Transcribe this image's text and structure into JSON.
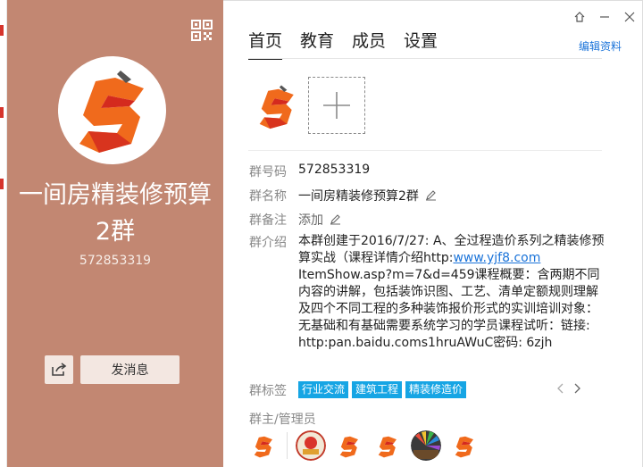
{
  "app": {
    "title": "一间房精装修预算2群",
    "group_id": "572853319"
  },
  "window": {
    "controls": [
      "pin-icon",
      "minimize-icon",
      "close-icon"
    ],
    "edit_link": "编辑资料"
  },
  "left": {
    "share_icon": "share-icon",
    "send_button": "发消息",
    "qr_icon": "qr-code-icon"
  },
  "tabs": [
    {
      "label": "首页",
      "active": true
    },
    {
      "label": "教育",
      "active": false
    },
    {
      "label": "成员",
      "active": false
    },
    {
      "label": "设置",
      "active": false
    }
  ],
  "info": {
    "id_label": "群号码",
    "id_value": "572853319",
    "name_label": "群名称",
    "name_value": "一间房精装修预算2群",
    "remark_label": "群备注",
    "remark_value": "添加",
    "intro_label": "群介绍",
    "intro_text_1": "本群创建于2016/7/27: A、全过程造价系列之精装修预算实战（课程详情介绍http:",
    "intro_link": "www.yjf8.com",
    "intro_text_2": "ItemShow.asp?m=7&d=459课程概要：含两期不同内容的讲解，包括装饰识图、工艺、清单定额规则理解及四个不同工程的多种装饰报价形式的实训培训对象：无基础和有基础需要系统学习的学员课程试听：链接: http:pan.baidu.coms1hruAWuC密码: 6zjh",
    "tags_label": "群标签",
    "tags": [
      "行业交流",
      "建筑工程",
      "精装修造价"
    ]
  },
  "admins": {
    "title": "群主/管理员",
    "count": 6
  },
  "colors": {
    "panel_bg": "#c28772",
    "tag_bg": "#16a5e4",
    "link": "#1a73d9",
    "logo_orange": "#f06a1c",
    "logo_red": "#d42a1e"
  }
}
